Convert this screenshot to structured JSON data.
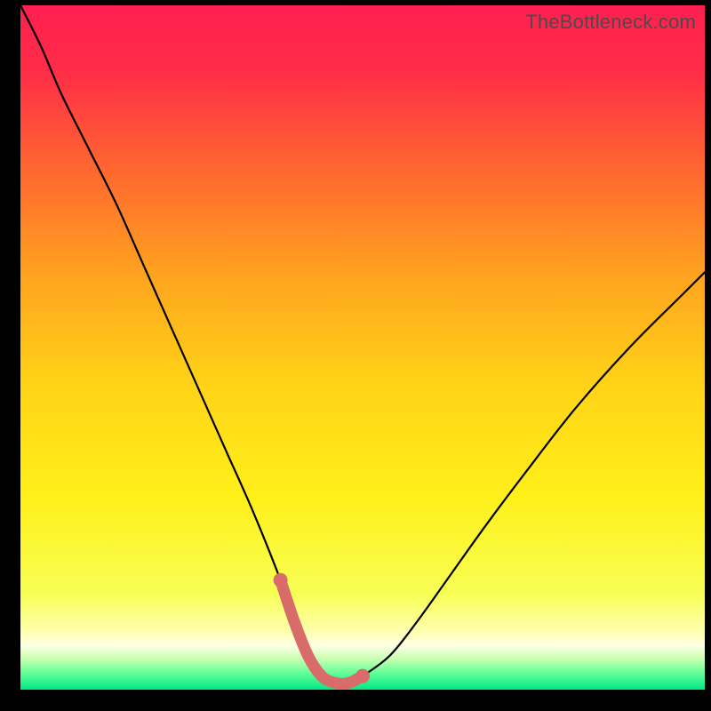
{
  "watermark": "TheBottleneck.com",
  "colors": {
    "page_bg": "#000000",
    "gradient_stops": [
      {
        "offset": 0.0,
        "color": "#ff1f50"
      },
      {
        "offset": 0.1,
        "color": "#ff2e47"
      },
      {
        "offset": 0.25,
        "color": "#ff6b2f"
      },
      {
        "offset": 0.4,
        "color": "#ffa51f"
      },
      {
        "offset": 0.55,
        "color": "#ffd217"
      },
      {
        "offset": 0.72,
        "color": "#fff01a"
      },
      {
        "offset": 0.86,
        "color": "#f7ff55"
      },
      {
        "offset": 0.915,
        "color": "#ffffae"
      },
      {
        "offset": 0.935,
        "color": "#ffffe6"
      },
      {
        "offset": 0.955,
        "color": "#c8ffb0"
      },
      {
        "offset": 0.975,
        "color": "#66ff99"
      },
      {
        "offset": 1.0,
        "color": "#00e986"
      }
    ],
    "curve_stroke": "#000000",
    "highlight_stroke": "#d96b6b",
    "highlight_fill": "#d96b6b"
  },
  "chart_data": {
    "type": "line",
    "title": "",
    "xlabel": "",
    "ylabel": "",
    "xlim": [
      0,
      100
    ],
    "ylim": [
      0,
      100
    ],
    "grid": false,
    "series": [
      {
        "name": "bottleneck-curve",
        "x": [
          0,
          3,
          6,
          10,
          14,
          18,
          22,
          26,
          30,
          34,
          38,
          40,
          42,
          44,
          46,
          48,
          50,
          54,
          58,
          63,
          68,
          74,
          81,
          89,
          97,
          100
        ],
        "y": [
          100,
          94,
          87,
          79,
          71,
          62,
          53,
          44,
          35,
          26,
          16,
          10,
          5,
          2,
          1,
          1,
          2,
          5,
          10,
          17,
          24,
          32,
          41,
          50,
          58,
          61
        ]
      }
    ],
    "annotations": [
      {
        "name": "optimal-range",
        "type": "highlight-segment",
        "x_start": 38,
        "x_end": 52,
        "note": "thick rounded pink overlay near curve minimum with endpoint dots"
      }
    ]
  }
}
